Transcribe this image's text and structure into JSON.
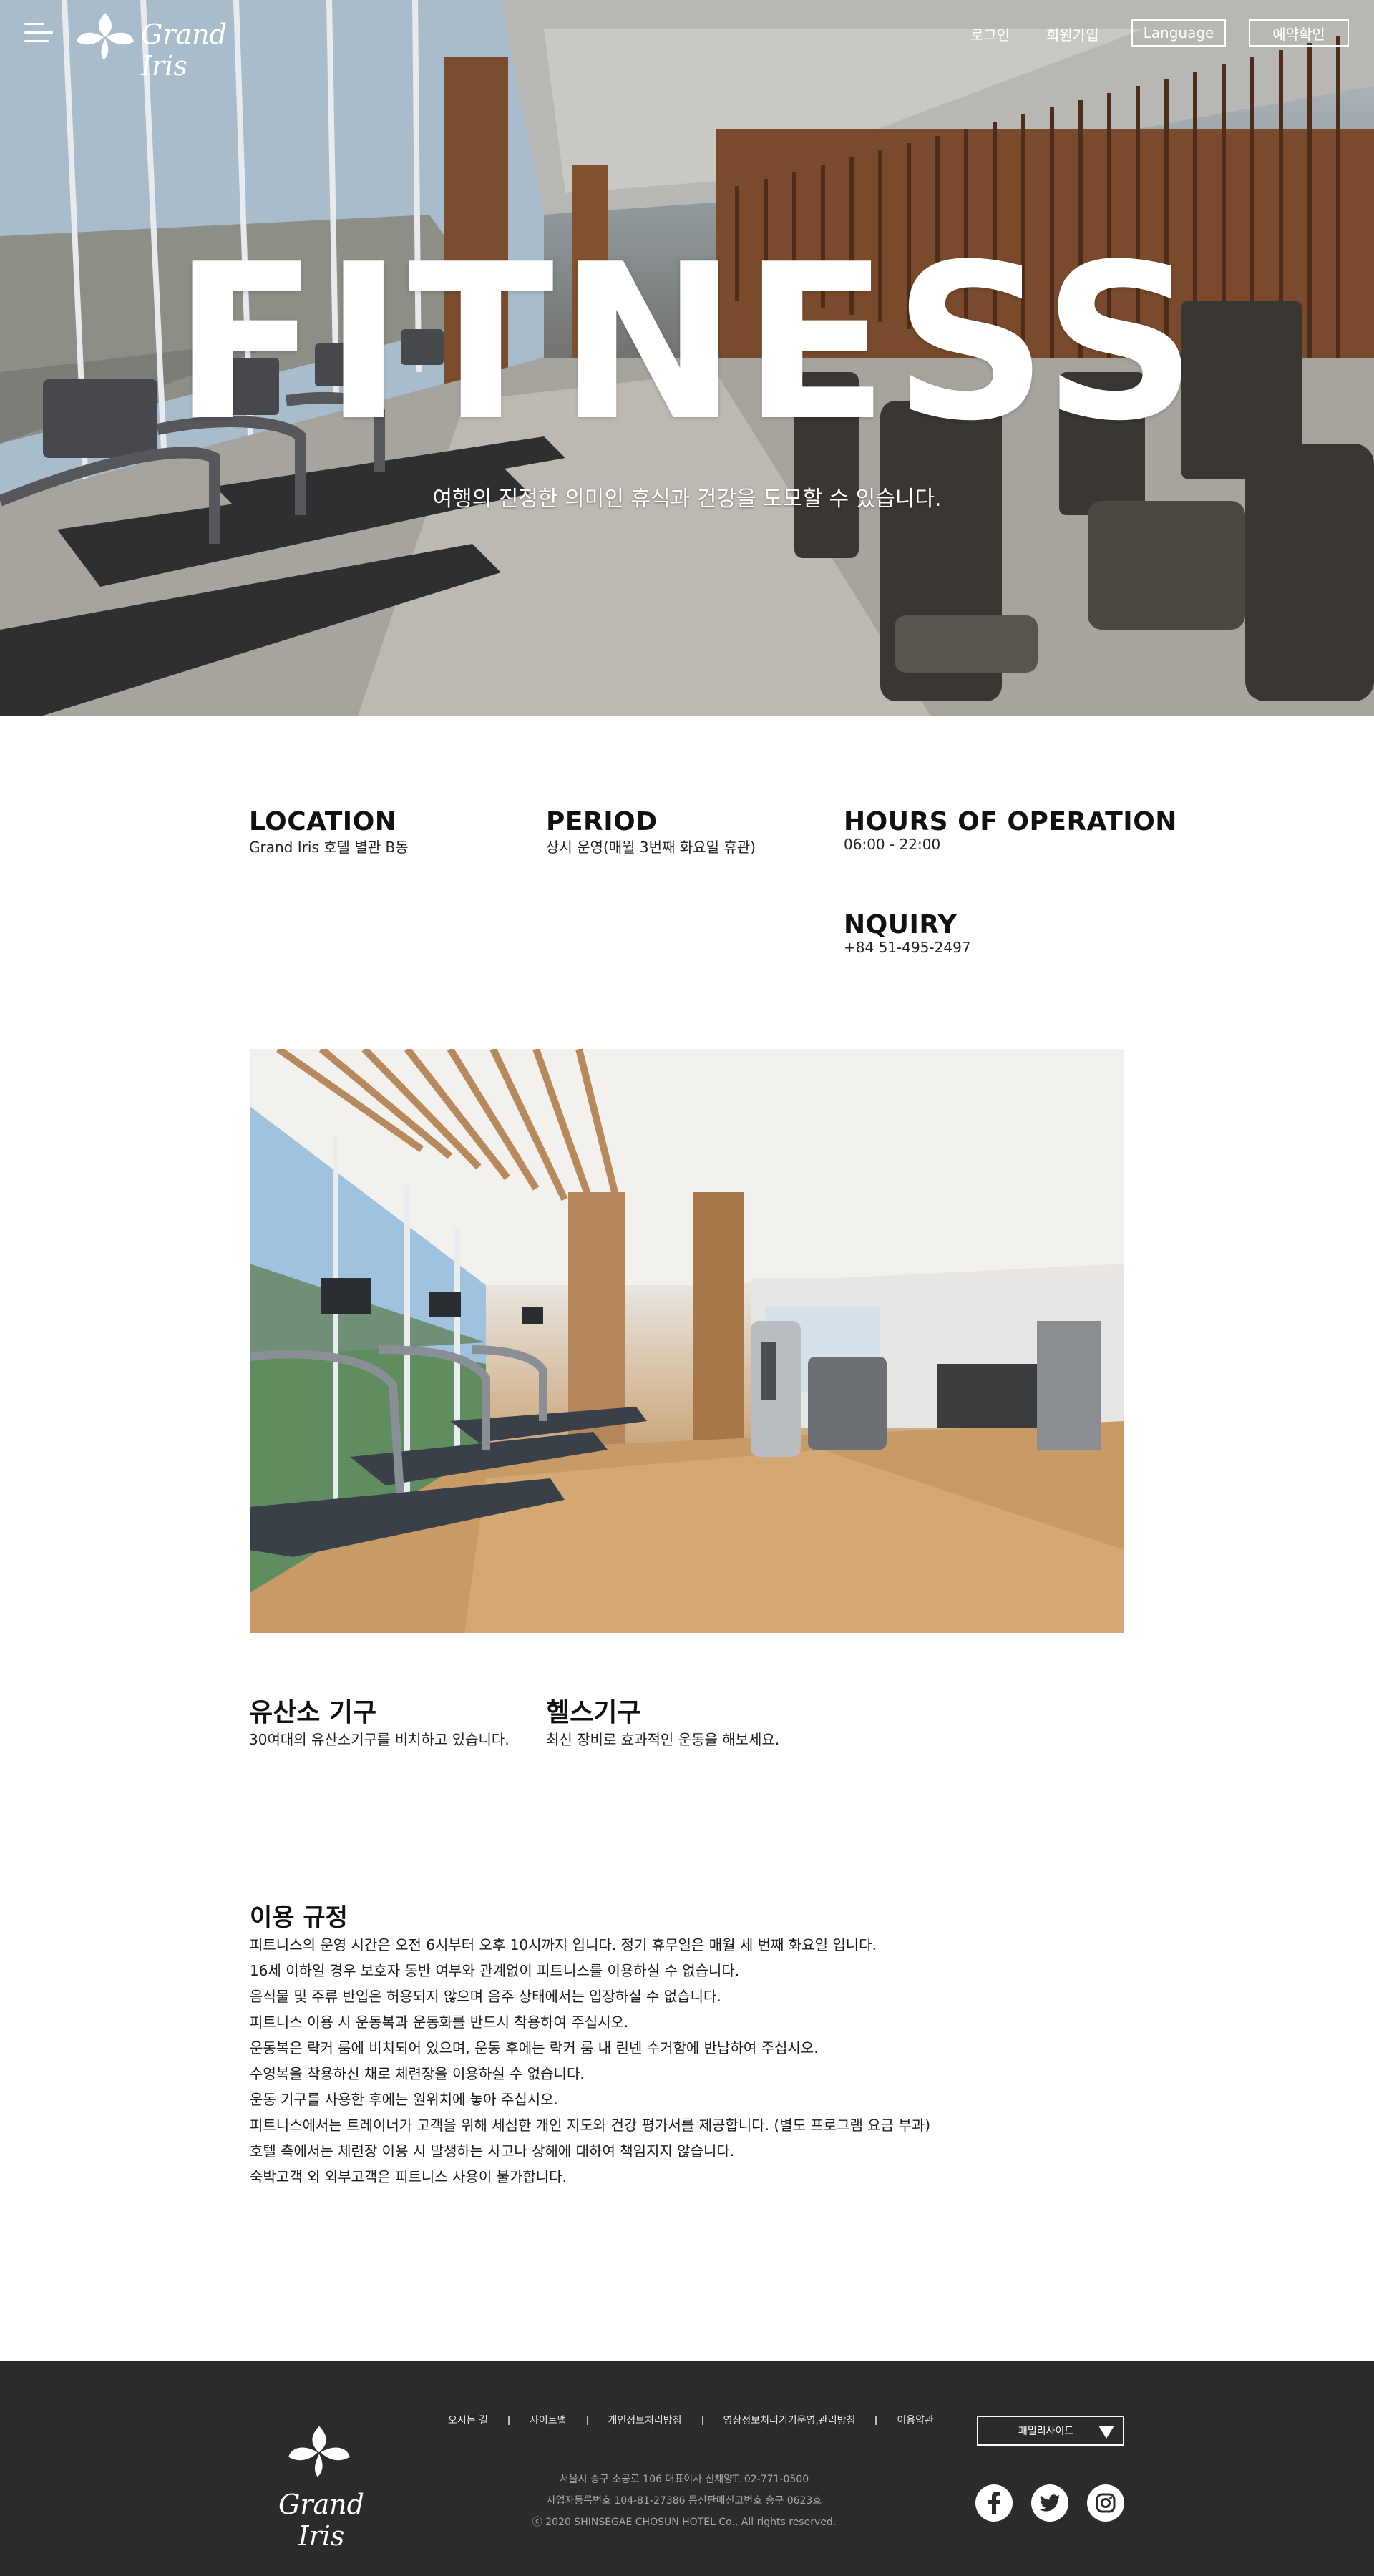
{
  "header": {
    "brand": "Grand Iris",
    "nav": {
      "login": "로그인",
      "signup": "회원가입",
      "language": "Language",
      "reservation": "예약확인"
    }
  },
  "hero": {
    "title": "FITNESS",
    "subtitle": "여행의 진정한 의미인 휴식과 건강을 도모할 수 있습니다."
  },
  "info": [
    {
      "heading": "LOCATION",
      "text": "Grand Iris 호텔 별관 B동"
    },
    {
      "heading": "PERIOD",
      "text": "상시 운영(매월 3번째 화요일 휴관)"
    },
    {
      "heading": "HOURS OF OPERATION",
      "text": "06:00 - 22:00"
    },
    {
      "heading": "NQUIRY",
      "text": "+84 51-495-2497"
    }
  ],
  "features": [
    {
      "heading": "유산소 기구",
      "text": "30여대의 유산소기구를 비치하고 있습니다."
    },
    {
      "heading": "헬스기구",
      "text": "최신 장비로 효과적인 운동을 해보세요."
    }
  ],
  "rules": {
    "heading": "이용 규정",
    "items": [
      "피트니스의 운영 시간은 오전 6시부터 오후 10시까지 입니다. 정기 휴무일은 매월 세 번째 화요일 입니다.",
      "16세 이하일 경우 보호자 동반 여부와 관계없이 피트니스를 이용하실 수 없습니다.",
      "음식물 및 주류 반입은 허용되지 않으며 음주 상태에서는 입장하실 수 없습니다.",
      "피트니스 이용 시 운동복과 운동화를 반드시 착용하여 주십시오.",
      "운동복은 락커 룸에 비치되어 있으며, 운동 후에는 락커 룸 내 린넨 수거함에 반납하여 주십시오.",
      "수영복을 착용하신 채로 체련장을 이용하실 수 없습니다.",
      "운동 기구를 사용한 후에는 원위치에 놓아 주십시오.",
      "피트니스에서는 트레이너가 고객을 위해 세심한 개인 지도와 건강 평가서를 제공합니다. (별도 프로그램 요금 부과)",
      "호텔 측에서는 체련장 이용 시 발생하는 사고나 상해에 대하여 책임지지 않습니다.",
      "숙박고객 외 외부고객은 피트니스 사용이 불가합니다."
    ]
  },
  "footer": {
    "brand": "Grand Iris",
    "links": [
      "오시는 길",
      "사이트맵",
      "개인정보처리방침",
      "영상정보처리기기운영,관리방침",
      "이용약관"
    ],
    "address": [
      "서울시 송구 소공로 106 대표이사 신채양T. 02-771-0500",
      "사업자등록번호 104-81-27386 통신판매신고번호 송구 0623호",
      "ⓒ 2020 SHINSEGAE CHOSUN HOTEL Co., All rights reserved."
    ],
    "family_site": "패밀리사이트",
    "social": [
      "facebook-icon",
      "twitter-icon",
      "instagram-icon"
    ]
  }
}
